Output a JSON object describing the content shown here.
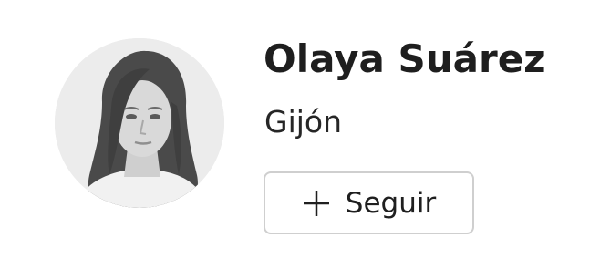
{
  "author": {
    "name": "Olaya Suárez",
    "location": "Gijón",
    "avatar_icon": "avatar-photo"
  },
  "follow_button": {
    "label": "Seguir",
    "icon": "plus-icon"
  },
  "colors": {
    "text": "#1e1e1e",
    "button_border": "#cfcfcf",
    "avatar_bg": "#e6e6e6"
  }
}
